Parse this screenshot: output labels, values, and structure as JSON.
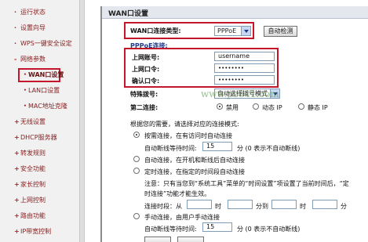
{
  "sidebar": {
    "items": [
      {
        "label": "运行状态",
        "marker": "·"
      },
      {
        "label": "设置向导",
        "marker": "·"
      },
      {
        "label": "WPS一键安全设定",
        "marker": "·"
      },
      {
        "label": "网络参数",
        "marker": "-"
      },
      {
        "label": "WAN口设置",
        "marker": "•"
      },
      {
        "label": "LAN口设置",
        "marker": "•"
      },
      {
        "label": "MAC地址克隆",
        "marker": "•"
      },
      {
        "label": "无线设置",
        "marker": "+"
      },
      {
        "label": "DHCP服务器",
        "marker": "+"
      },
      {
        "label": "转发规则",
        "marker": "+"
      },
      {
        "label": "安全功能",
        "marker": "+"
      },
      {
        "label": "家长控制",
        "marker": "+"
      },
      {
        "label": "上网控制",
        "marker": "+"
      },
      {
        "label": "路由功能",
        "marker": "+"
      },
      {
        "label": "IP带宽控制",
        "marker": "+"
      }
    ]
  },
  "main": {
    "title": "WAN口设置",
    "wan_type_label": "WAN口连接类型:",
    "wan_type_value": "PPPoE",
    "auto_detect_label": "自动检测",
    "pppoe_label": "PPPoE连接:",
    "account_label": "上网账号:",
    "account_value": "username",
    "password_label": "上网口令:",
    "password_value": "••••••••",
    "confirm_label": "确认口令:",
    "confirm_value": "••••••••",
    "special_dial_label": "特殊拨号:",
    "special_dial_value": "自动选择拨号模式",
    "second_conn_label": "第二连接:",
    "second_options": [
      "禁用",
      "动态 IP",
      "静态 IP"
    ],
    "mode_intro": "根据您的需要，请选择对应的连接模式:",
    "mode_on_demand": "按需连接，在有访问时自动连接",
    "auto_disconnect_label": "自动断线等待时间:",
    "auto_disconnect_value": "15",
    "minutes_hint": "分 (0 表示不自动断线)",
    "mode_auto": "自动连接，在开机和断线后自动连接",
    "mode_timed": "定时连接，在指定的时间段自动连接",
    "timed_note_1": "注意：只有当您到“系统工具”菜单的“时间设置”项设置了当前时间后，“定",
    "timed_note_2": "时连接”功能才能生效。",
    "period_from": "连接时段：从",
    "hour": "时",
    "minute_to": "分到",
    "minute": "分",
    "mode_manual": "手动连接，由用户手动连接",
    "manual_wait_value": "15",
    "watermark": "www.pc841.com"
  }
}
